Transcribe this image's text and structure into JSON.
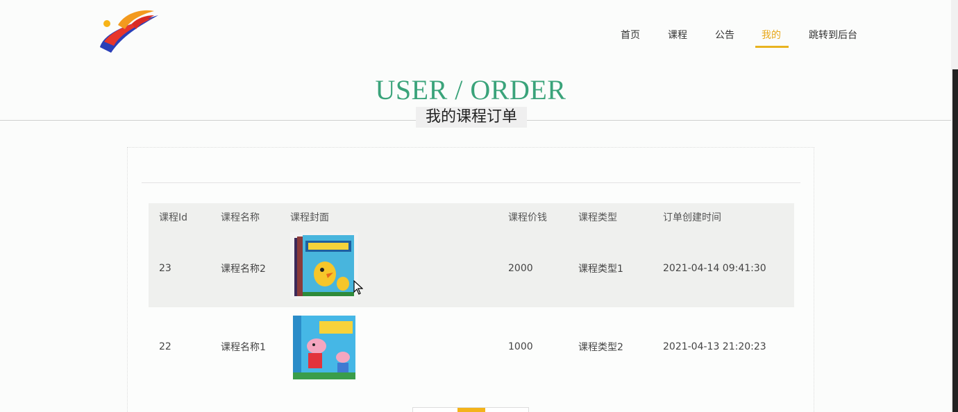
{
  "nav": {
    "items": [
      {
        "label": "首页"
      },
      {
        "label": "课程"
      },
      {
        "label": "公告"
      },
      {
        "label": "我的"
      },
      {
        "label": "跳转到后台"
      }
    ],
    "active_index": 3
  },
  "header": {
    "title_en": "USER / ORDER",
    "title_cn": "我的课程订单"
  },
  "table": {
    "columns": [
      "课程Id",
      "课程名称",
      "课程封面",
      "课程价钱",
      "课程类型",
      "订单创建时间"
    ],
    "rows": [
      {
        "id": "23",
        "name": "课程名称2",
        "cover": "book-cover-duck",
        "price": "2000",
        "type": "课程类型1",
        "created": "2021-04-14 09:41:30"
      },
      {
        "id": "22",
        "name": "课程名称1",
        "cover": "book-cover-peppa",
        "price": "1000",
        "type": "课程类型2",
        "created": "2021-04-13 21:20:23"
      }
    ]
  },
  "colors": {
    "accent": "#e8a81a",
    "title_green": "#3aa37a"
  }
}
